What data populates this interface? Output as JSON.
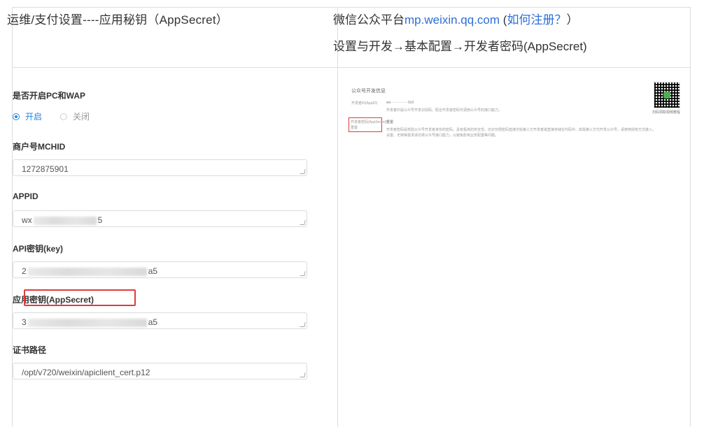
{
  "header": {
    "left_title": "运维/支付设置----应用秘钥（AppSecret）",
    "right_title_prefix": "微信公众平台",
    "right_title_link": "mp.weixin.qq.com",
    "right_title_paren_open": " (",
    "right_title_help": "如何注册？",
    "right_title_paren_close": "）",
    "right_path": "设置与开发→基本配置→开发者密码(AppSecret)"
  },
  "form": {
    "pc_wap_label": "是否开启PC和WAP",
    "radio_on_label": "开启",
    "radio_off_label": "关闭",
    "radio_selected": "开启",
    "mchid_label": "商户号MCHID",
    "mchid_value": "1272875901",
    "appid_label": "APPID",
    "appid_prefix": "wx",
    "appid_suffix": "5",
    "apikey_label": "API密钥(key)",
    "apikey_prefix": "2",
    "apikey_suffix": "a5",
    "appsecret_label": "应用密钥(AppSecret)",
    "appsecret_prefix": "3",
    "appsecret_suffix": "a5",
    "cert_label": "证书路径",
    "cert_value": "/opt/v720/weixin/apiclient_cert.p12"
  },
  "thumbnail": {
    "title": "公众号开发信息",
    "row1_label": "开发者ID(AppID)",
    "row1_value": "wx···············5c0",
    "row1_note": "开发者ID是公众号开发识别码，配合开发者密码可调用公众号的接口能力。",
    "row2_label": "开发者密码(AppSecret)",
    "row2_sub": "重置",
    "row2_note_1": "开发者密码是校验公众号开发者身份的密码，具有极高的安全性。切记勿把密码直接交给第三方开发者或直接存储在代码中。如需第三方代开发公众号，请使用授权方式接入。",
    "row2_note_2": "设置。无特殊需求请勿将公众号接口能力，以避免影响业务配置等问题。",
    "qr_caption": "扫码领取视频教程"
  },
  "colors": {
    "accent": "#1e88e5",
    "link": "#2b6fd6",
    "highlight": "#e03b3b"
  }
}
